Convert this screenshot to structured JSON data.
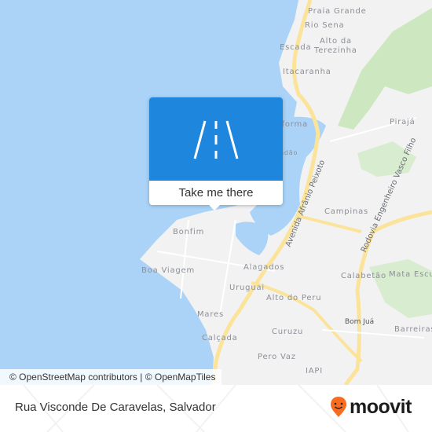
{
  "map": {
    "place_labels": [
      {
        "name": "Praia Grande",
        "id": "praia-grande"
      },
      {
        "name": "Rio Sena",
        "id": "rio-sena"
      },
      {
        "name": "Alto da",
        "id": "alto-da-terezinha-1"
      },
      {
        "name": "Terezinha",
        "id": "alto-da-terezinha-2"
      },
      {
        "name": "Escada",
        "id": "escada"
      },
      {
        "name": "Itacaranha",
        "id": "itacaranha"
      },
      {
        "name": "Plataforma",
        "id": "plataforma"
      },
      {
        "name": "Lobato / Rendão",
        "id": "rendao"
      },
      {
        "name": "Pirajá",
        "id": "piraja"
      },
      {
        "name": "Campinas",
        "id": "campinas"
      },
      {
        "name": "Bonfim",
        "id": "bonfim"
      },
      {
        "name": "Boa Viagem",
        "id": "boa-viagem"
      },
      {
        "name": "Alagados",
        "id": "alagados"
      },
      {
        "name": "Uruguai",
        "id": "uruguai"
      },
      {
        "name": "Alto do Peru",
        "id": "alto-do-peru"
      },
      {
        "name": "Calabetão",
        "id": "calabetao"
      },
      {
        "name": "Mata Escura",
        "id": "mata-escura"
      },
      {
        "name": "Bom Juá",
        "id": "bom-jua"
      },
      {
        "name": "Barreiras",
        "id": "barreiras"
      },
      {
        "name": "Mares",
        "id": "mares"
      },
      {
        "name": "Calçada",
        "id": "calcada"
      },
      {
        "name": "Curuzu",
        "id": "curuzu"
      },
      {
        "name": "Pero Vaz",
        "id": "pero-vaz"
      },
      {
        "name": "IAPI",
        "id": "iapi"
      }
    ],
    "road_labels": [
      {
        "name": "Avenida Afrânio Peixoto"
      },
      {
        "name": "Rodovia Engenheiro Vasco Filho"
      }
    ],
    "attribution": "© OpenStreetMap contributors | © OpenMapTiles",
    "colors": {
      "water": "#aad3f7",
      "land": "#f2f2f3",
      "park": "#cde8c0",
      "road_major": "#fbe49a"
    }
  },
  "popup": {
    "action_label": "Take me there",
    "icon": "road-icon",
    "color": "#1f86dd"
  },
  "footer": {
    "location_title": "Rua Visconde De Caravelas, Salvador",
    "brand": "moovit",
    "brand_color": "#f96b1f"
  }
}
